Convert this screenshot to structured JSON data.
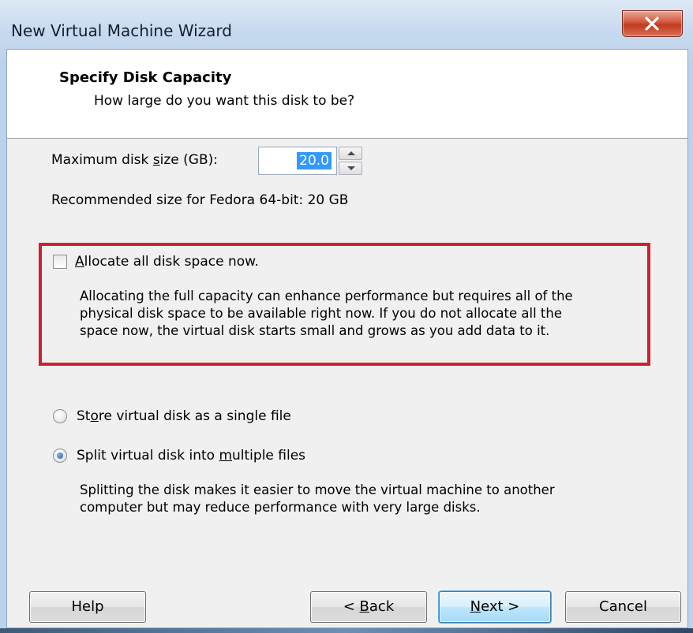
{
  "window": {
    "title": "New Virtual Machine Wizard"
  },
  "header": {
    "title": "Specify Disk Capacity",
    "subtitle": "How large do you want this disk to be?"
  },
  "disk_size": {
    "label_pre": "Maximum disk ",
    "label_mnemonic": "s",
    "label_post": "ize (GB):",
    "value": "20.0",
    "recommended": "Recommended size for Fedora 64-bit: 20 GB"
  },
  "allocate": {
    "checked": false,
    "label_mnemonic": "A",
    "label_rest": "llocate all disk space now.",
    "description": [
      "Allocating the full capacity can enhance performance but requires all of the",
      "physical disk space to be available right now. If you do not allocate all the",
      "space now, the virtual disk starts small and grows as you add data to it."
    ]
  },
  "storage": {
    "single": {
      "label_pre": "St",
      "label_mnemonic": "o",
      "label_post": "re virtual disk as a single file",
      "selected": false
    },
    "split": {
      "label_pre": "Split virtual disk into ",
      "label_mnemonic": "m",
      "label_post": "ultiple files",
      "selected": true
    },
    "split_description": [
      "Splitting the disk makes it easier to move the virtual machine to another",
      "computer but may reduce performance with very large disks."
    ]
  },
  "buttons": {
    "help": "Help",
    "back_pre": "< ",
    "back_mnemonic": "B",
    "back_post": "ack",
    "next_mnemonic": "N",
    "next_post": "ext >",
    "cancel": "Cancel"
  },
  "colors": {
    "highlight_border": "#d0202e",
    "selection": "#3399ff"
  }
}
